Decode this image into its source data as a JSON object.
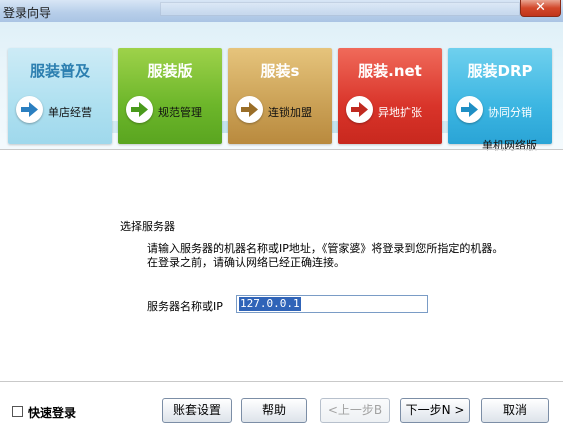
{
  "window": {
    "title": "登录向导",
    "close_label": "✕"
  },
  "banner": {
    "tiles": [
      {
        "name": "服装普及",
        "subtitle": "单店经营",
        "color": "#aee0f0",
        "icon": "arrow-right-icon"
      },
      {
        "name": "服装版",
        "subtitle": "规范管理",
        "color": "#6cb62a",
        "icon": "arrow-right-icon"
      },
      {
        "name": "服装s",
        "subtitle": "连锁加盟",
        "color": "#caa055",
        "icon": "arrow-right-icon"
      },
      {
        "name": "服装.net",
        "subtitle": "异地扩张",
        "color": "#d9342a",
        "icon": "arrow-right-icon"
      },
      {
        "name": "服装DRP",
        "subtitle": "协同分销",
        "color": "#3cb6e2",
        "icon": "arrow-right-icon"
      }
    ],
    "edition": "单机网络版"
  },
  "content": {
    "section_title": "选择服务器",
    "description_line1": "请输入服务器的机器名称或IP地址，《管家婆》将登录到您所指定的机器。",
    "description_line2": "在登录之前，请确认网络已经正确连接。",
    "server_label": "服务器名称或IP",
    "server_value": "127.0.0.1"
  },
  "footer": {
    "quick_login_label": "快速登录",
    "quick_login_checked": false,
    "buttons": {
      "account_settings": "账套设置",
      "help": "帮助",
      "prev": "<上一步B",
      "next": "下一步N >",
      "cancel": "取消"
    }
  }
}
